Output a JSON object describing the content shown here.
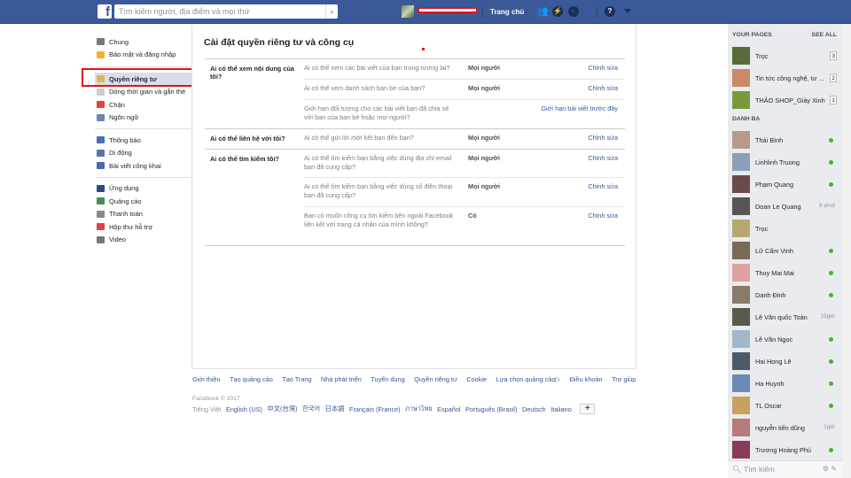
{
  "header": {
    "search_placeholder": "Tìm kiếm người, địa điểm và mọi thứ",
    "home": "Trang chủ"
  },
  "leftnav": {
    "groups": [
      [
        {
          "label": "Chung",
          "color": "#777"
        },
        {
          "label": "Bảo mật và đăng nhập",
          "color": "#f0b429"
        }
      ],
      [
        {
          "label": "Quyền riêng tư",
          "color": "#e8b44a",
          "active": true
        },
        {
          "label": "Dòng thời gian và gắn thẻ",
          "color": "#ccc"
        },
        {
          "label": "Chặn",
          "color": "#e0473a"
        },
        {
          "label": "Ngôn ngữ",
          "color": "#6d84b4"
        }
      ],
      [
        {
          "label": "Thông báo",
          "color": "#4a6fb5"
        },
        {
          "label": "Di động",
          "color": "#5b74a8"
        },
        {
          "label": "Bài viết công khai",
          "color": "#4a6aa5"
        }
      ],
      [
        {
          "label": "Ứng dụng",
          "color": "#2c4a7c"
        },
        {
          "label": "Quảng cáo",
          "color": "#4a8a5a"
        },
        {
          "label": "Thanh toán",
          "color": "#888"
        },
        {
          "label": "Hộp thư hỗ trợ",
          "color": "#e04040"
        },
        {
          "label": "Video",
          "color": "#777"
        }
      ]
    ]
  },
  "main": {
    "title": "Cài đặt quyền riêng tư và công cụ",
    "sections": [
      {
        "label": "Ai có thể xem nội dung của tôi?",
        "rows": [
          {
            "q": "Ai có thể xem các bài viết của bạn trong tương lai?",
            "v": "Mọi người",
            "a": "Chỉnh sửa"
          },
          {
            "q": "Ai có thể xem danh sách bạn bè của bạn?",
            "v": "Mọi người",
            "a": "Chỉnh sửa"
          },
          {
            "q": "Giới hạn đối tượng cho các bài viết bạn đã chia sẻ với bạn của bạn bè hoặc mọi người?",
            "v": "",
            "a": "Giới hạn bài viết trước đây"
          }
        ]
      },
      {
        "label": "Ai có thể liên hệ với tôi?",
        "rows": [
          {
            "q": "Ai có thể gửi lời mời kết bạn đến bạn?",
            "v": "Mọi người",
            "a": "Chỉnh sửa"
          }
        ]
      },
      {
        "label": "Ai có thể tìm kiếm tôi?",
        "rows": [
          {
            "q": "Ai có thể tìm kiếm bạn bằng việc dùng địa chỉ email bạn đã cung cấp?",
            "v": "Mọi người",
            "a": "Chỉnh sửa"
          },
          {
            "q": "Ai có thể tìm kiếm bạn bằng việc dùng số điện thoại bạn đã cung cấp?",
            "v": "Mọi người",
            "a": "Chỉnh sửa"
          },
          {
            "q": "Bạn có muốn công cụ tìm kiếm bên ngoài Facebook liên kết với trang cá nhân của mình không?",
            "v": "Có",
            "a": "Chỉnh sửa"
          }
        ]
      }
    ]
  },
  "footer": {
    "links": [
      "Giới thiệu",
      "Tạo quảng cáo",
      "Tạo Trang",
      "Nhà phát triển",
      "Tuyển dụng",
      "Quyền riêng tư",
      "Cookie",
      "Lựa chọn quảng cáo▷",
      "Điều khoản",
      "Trợ giúp"
    ],
    "copyright": "Facebook © 2017",
    "current_lang": "Tiếng Việt",
    "langs": [
      "English (US)",
      "中文(台灣)",
      "한국어",
      "日本語",
      "Français (France)",
      "ภาษาไทย",
      "Español",
      "Português (Brasil)",
      "Deutsch",
      "Italiano"
    ],
    "more": "+"
  },
  "sidebar": {
    "pages_title": "YOUR PAGES",
    "see_all": "SEE ALL",
    "pages": [
      {
        "name": "Trọc",
        "count": "3",
        "color": "#5a6b3a"
      },
      {
        "name": "Tin tức công nghệ, tư ...",
        "count": "2",
        "color": "#c98a6a"
      },
      {
        "name": "THẢO SHOP_Giày Xinh",
        "count": "1",
        "color": "#7a9a3a"
      }
    ],
    "contacts_title": "DANH BẠ",
    "contacts": [
      {
        "name": "Thái Bình",
        "status": "online",
        "color": "#b89a8a"
      },
      {
        "name": "Linhlinh Truong",
        "status": "online",
        "color": "#8aa0b8"
      },
      {
        "name": "Phạm Quang",
        "status": "online",
        "color": "#6a4a4a"
      },
      {
        "name": "Doan Le Quang",
        "status": "9 phút",
        "color": "#555"
      },
      {
        "name": "Trọc",
        "status": "",
        "color": "#b8a870"
      },
      {
        "name": "Lữ Cẩm Vinh",
        "status": "online",
        "color": "#7a6a5a"
      },
      {
        "name": "Thuy Mai Mai",
        "status": "online",
        "color": "#e0a0a0"
      },
      {
        "name": "Danh Đinh",
        "status": "online",
        "color": "#8a7a6a"
      },
      {
        "name": "Lê Văn quốc Toản",
        "status": "15giờ",
        "color": "#5a5a4a"
      },
      {
        "name": "Lê Văn Ngọc",
        "status": "online",
        "color": "#a0b8c8"
      },
      {
        "name": "Hai Hong Lê",
        "status": "online",
        "color": "#4a5a6a"
      },
      {
        "name": "Ha Huynh",
        "status": "online",
        "color": "#6a8ab8"
      },
      {
        "name": "TL Oscar",
        "status": "online",
        "color": "#c8a060"
      },
      {
        "name": "nguyễn tiến dũng",
        "status": "1giờ",
        "color": "#b87a7a"
      },
      {
        "name": "Trương Hoàng Phú",
        "status": "online",
        "color": "#8a3a5a"
      }
    ],
    "search_placeholder": "Tìm kiếm"
  }
}
